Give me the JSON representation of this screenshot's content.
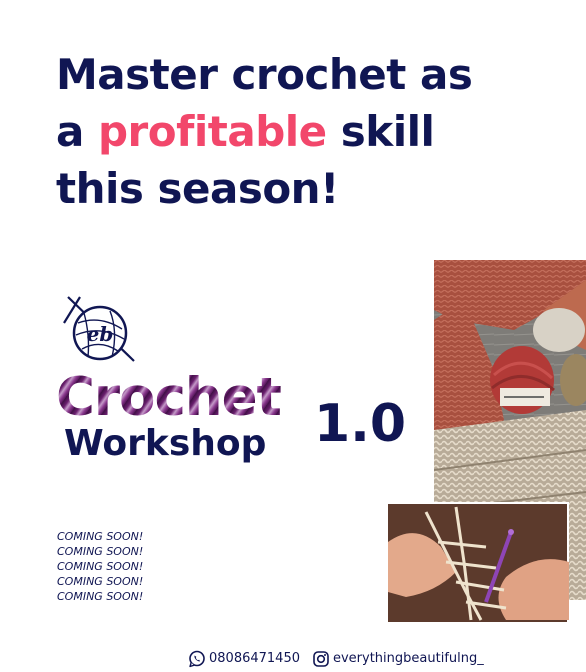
{
  "headline": {
    "line1": "Master crochet as",
    "line2_prefix": "a ",
    "line2_highlight": "profitable",
    "line2_suffix": " skill",
    "line3": "this season!"
  },
  "logo": {
    "monogram": "eb"
  },
  "title": {
    "word1": "Crochet",
    "word2": "Workshop",
    "version": "1.0"
  },
  "coming_soon": [
    "COMING SOON!",
    "COMING SOON!",
    "COMING SOON!",
    "COMING SOON!",
    "COMING SOON!"
  ],
  "footer": {
    "phone": "08086471450",
    "phone_icon": "whatsapp-icon",
    "instagram_handle": "everythingbeautifulng_",
    "instagram_icon": "instagram-icon"
  },
  "colors": {
    "navy": "#101653",
    "pink": "#f2476b",
    "purple": "#8b3a8f",
    "background": "#ffffff"
  }
}
